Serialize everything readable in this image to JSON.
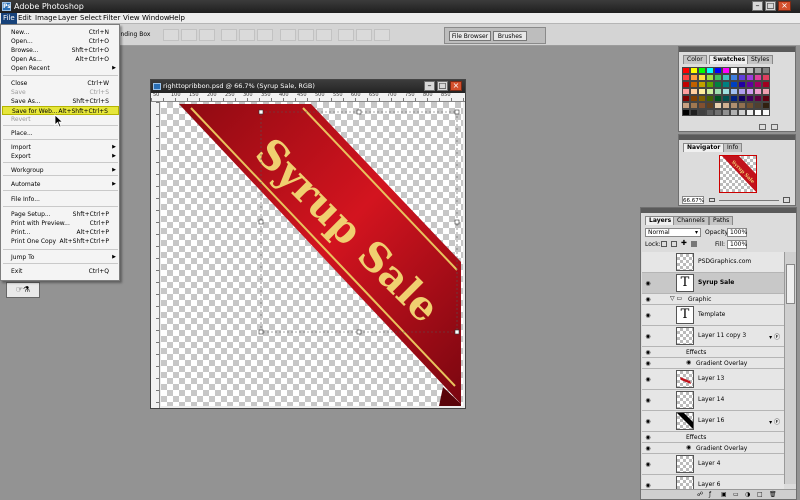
{
  "titlebar": {
    "title": "Adobe Photoshop"
  },
  "menubar": [
    "File",
    "Edit",
    "Image",
    "Layer",
    "Select",
    "Filter",
    "View",
    "Window",
    "Help"
  ],
  "options": {
    "checkbox_label": "ounding Box"
  },
  "well": {
    "file_browser": "File Browser",
    "brushes": "Brushes"
  },
  "file_menu": {
    "items": [
      {
        "label": "New...",
        "shortcut": "Ctrl+N"
      },
      {
        "label": "Open...",
        "shortcut": "Ctrl+O"
      },
      {
        "label": "Browse...",
        "shortcut": "Shft+Ctrl+O"
      },
      {
        "label": "Open As...",
        "shortcut": "Alt+Ctrl+O"
      },
      {
        "label": "Open Recent",
        "shortcut": ""
      },
      {
        "label": "Close",
        "shortcut": "Ctrl+W"
      },
      {
        "label": "Save",
        "shortcut": "Ctrl+S"
      },
      {
        "label": "Save As...",
        "shortcut": "Shft+Ctrl+S"
      },
      {
        "label": "Save for Web...",
        "shortcut": "Alt+Shft+Ctrl+S"
      },
      {
        "label": "Revert",
        "shortcut": ""
      },
      {
        "label": "Place...",
        "shortcut": ""
      },
      {
        "label": "Import",
        "shortcut": ""
      },
      {
        "label": "Export",
        "shortcut": ""
      },
      {
        "label": "Workgroup",
        "shortcut": ""
      },
      {
        "label": "Automate",
        "shortcut": ""
      },
      {
        "label": "File Info...",
        "shortcut": ""
      },
      {
        "label": "Page Setup...",
        "shortcut": "Shft+Ctrl+P"
      },
      {
        "label": "Print with Preview...",
        "shortcut": "Ctrl+P"
      },
      {
        "label": "Print...",
        "shortcut": "Alt+Ctrl+P"
      },
      {
        "label": "Print One Copy",
        "shortcut": "Alt+Shft+Ctrl+P"
      },
      {
        "label": "Jump To",
        "shortcut": ""
      },
      {
        "label": "Exit",
        "shortcut": "Ctrl+Q"
      }
    ]
  },
  "document": {
    "title": "righttopribbon.psd @ 66.7% (Syrup Sale, RGB)",
    "ruler_ticks": [
      "50",
      "100",
      "150",
      "200",
      "250",
      "300",
      "350",
      "400",
      "450",
      "500",
      "550",
      "600",
      "650",
      "700",
      "750",
      "800",
      "850"
    ],
    "ribbon_text": "Syrup Sale",
    "ribbon_color": "#c1121c",
    "ribbon_text_color": "#f0d070"
  },
  "swatches_panel": {
    "tabs": [
      "Color",
      "Swatches",
      "Styles"
    ],
    "colors": [
      "#ff0000",
      "#ffff00",
      "#00ff00",
      "#00ffff",
      "#0000ff",
      "#ff00ff",
      "#ffffff",
      "#e0e0e0",
      "#c0c0c0",
      "#a0a0a0",
      "#808080",
      "#ff3f3f",
      "#ff9f3f",
      "#ffdf3f",
      "#9fdf3f",
      "#3fbf5f",
      "#3fbfbf",
      "#3f7fdf",
      "#5f3fdf",
      "#9f3fdf",
      "#df3f9f",
      "#df3f5f",
      "#c00000",
      "#c06000",
      "#c0a000",
      "#60a000",
      "#008040",
      "#008080",
      "#0040c0",
      "#2000a0",
      "#6000a0",
      "#a00060",
      "#a00020",
      "#ff9f9f",
      "#ffcf9f",
      "#ffef9f",
      "#cfef9f",
      "#9fdfaf",
      "#9fdfdf",
      "#9fbfef",
      "#af9fef",
      "#cf9fef",
      "#ef9fcf",
      "#ef9faf",
      "#800000",
      "#804000",
      "#806000",
      "#406000",
      "#005020",
      "#005050",
      "#002080",
      "#100060",
      "#400060",
      "#600040",
      "#600010",
      "#c8a080",
      "#a07850",
      "#805030",
      "#604020",
      "#e8d0b0",
      "#d0b090",
      "#b09070",
      "#907050",
      "#705030",
      "#504030",
      "#302010",
      "#000000",
      "#202020",
      "#404040",
      "#606060",
      "#707070",
      "#909090",
      "#b0b0b0",
      "#d0d0d0",
      "#f0f0f0",
      "#ffffff",
      "#f8f8f8"
    ]
  },
  "navigator_panel": {
    "tabs": [
      "Navigator",
      "Info"
    ],
    "zoom": "66.67%"
  },
  "layers_panel": {
    "tabs": [
      "Layers",
      "Channels",
      "Paths"
    ],
    "blend_mode": "Normal",
    "opacity_label": "Opacity:",
    "opacity_value": "100%",
    "lock_label": "Lock:",
    "fill_label": "Fill:",
    "fill_value": "100%",
    "rows": [
      {
        "name": "PSDGraphics.com",
        "kind": "layer"
      },
      {
        "name": "Syrup Sale",
        "kind": "text"
      },
      {
        "name": "Graphic",
        "kind": "group"
      },
      {
        "name": "Template",
        "kind": "text"
      },
      {
        "name": "Layer 11 copy 3",
        "kind": "layer"
      },
      {
        "name": "Effects",
        "kind": "effects"
      },
      {
        "name": "Gradient Overlay",
        "kind": "effect"
      },
      {
        "name": "Layer 13",
        "kind": "layer"
      },
      {
        "name": "Layer 14",
        "kind": "layer"
      },
      {
        "name": "Layer 16",
        "kind": "layer"
      },
      {
        "name": "Effects",
        "kind": "effects"
      },
      {
        "name": "Gradient Overlay",
        "kind": "effect"
      },
      {
        "name": "Layer 4",
        "kind": "layer"
      },
      {
        "name": "Layer 6",
        "kind": "layer"
      }
    ]
  }
}
